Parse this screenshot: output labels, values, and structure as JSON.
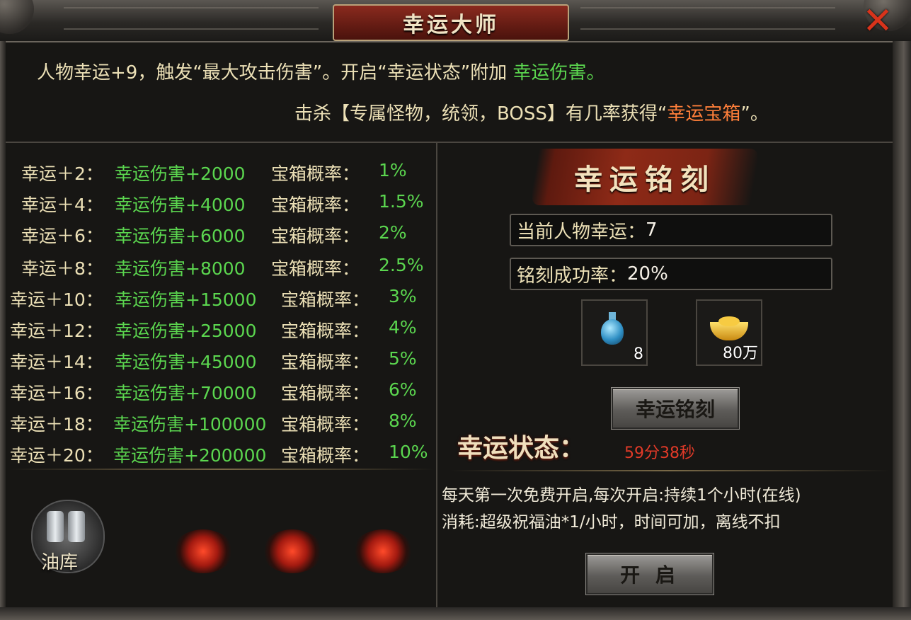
{
  "window": {
    "title": "幸运大师",
    "close_symbol": "✕"
  },
  "intro": {
    "line1_prefix": "人物幸运+9，触发“最大攻击伤害”。开启“幸运状态”附加",
    "line1_green": "幸运伤害。",
    "line2_prefix": "击杀【专属怪物，统领，BOSS】有几率获得“",
    "line2_orange": "幸运宝箱",
    "line2_suffix": "”。"
  },
  "luck_table": [
    {
      "level": "幸运＋2：",
      "damage": "幸运伤害+2000",
      "chest_label": "宝箱概率：",
      "chest_rate": "1%"
    },
    {
      "level": "幸运＋4：",
      "damage": "幸运伤害+4000",
      "chest_label": "宝箱概率：",
      "chest_rate": "1.5%"
    },
    {
      "level": "幸运＋6：",
      "damage": "幸运伤害+6000",
      "chest_label": "宝箱概率：",
      "chest_rate": "2%"
    },
    {
      "level": "幸运＋8：",
      "damage": "幸运伤害+8000",
      "chest_label": "宝箱概率：",
      "chest_rate": "2.5%"
    },
    {
      "level": "幸运＋10：",
      "damage": "幸运伤害+15000",
      "chest_label": "宝箱概率：",
      "chest_rate": "3%"
    },
    {
      "level": "幸运＋12：",
      "damage": "幸运伤害+25000",
      "chest_label": "宝箱概率：",
      "chest_rate": "4%"
    },
    {
      "level": "幸运＋14：",
      "damage": "幸运伤害+45000",
      "chest_label": "宝箱概率：",
      "chest_rate": "5%"
    },
    {
      "level": "幸运＋16：",
      "damage": "幸运伤害+70000",
      "chest_label": "宝箱概率：",
      "chest_rate": "6%"
    },
    {
      "level": "幸运＋18：",
      "damage": "幸运伤害+100000",
      "chest_label": "宝箱概率：",
      "chest_rate": "8%"
    },
    {
      "level": "幸运＋20：",
      "damage": "幸运伤害+200000",
      "chest_label": "宝箱概率：",
      "chest_rate": "10%"
    }
  ],
  "oil_depot": {
    "label": "油库",
    "icon": "oil-barrels-icon"
  },
  "engrave": {
    "title": "幸运铭刻",
    "current_luck_label": "当前人物幸运：",
    "current_luck_value": "7",
    "success_rate_label": "铭刻成功率：",
    "success_rate_value": "20%",
    "items": [
      {
        "icon": "blue-potion-icon",
        "count": "8"
      },
      {
        "icon": "gold-ingot-icon",
        "count": "80万"
      }
    ],
    "button_label": "幸运铭刻"
  },
  "luck_status": {
    "label": "幸运状态：",
    "timer": "59分38秒",
    "desc1": "每天第一次免费开启,每次开启:持续1个小时(在线)",
    "desc2": "消耗:超级祝福油*1/小时，时间可加，离线不扣",
    "open_button": "开 启"
  },
  "colors": {
    "accent_green": "#5bd64f",
    "accent_orange": "#ff7f3a",
    "timer_red": "#e23a28",
    "text_cream": "#ece0b6"
  }
}
